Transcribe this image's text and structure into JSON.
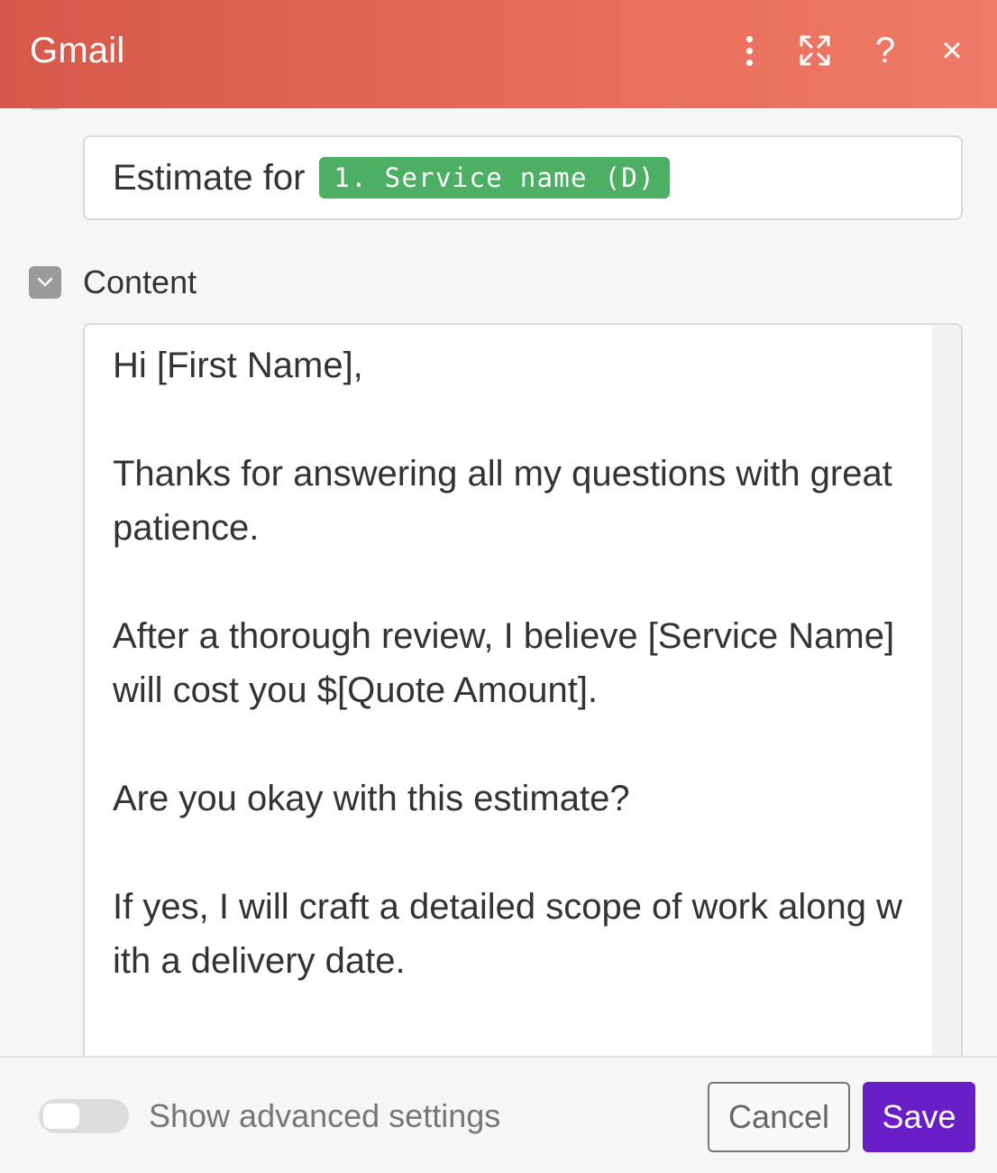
{
  "header": {
    "title": "Gmail",
    "icons": [
      "more-options-icon",
      "expand-icon",
      "help-icon",
      "close-icon"
    ],
    "help_label": "?",
    "close_label": "×",
    "gradient_colors": [
      "#d6584a",
      "#f07a67"
    ]
  },
  "subject": {
    "prefix_text": "Estimate for",
    "pill_text": "1. Service name (D)",
    "pill_color": "#4caf63"
  },
  "content": {
    "label": "Content",
    "paragraphs": [
      "Hi [First Name],",
      "Thanks for answering all my questions with great patience.",
      "After a thorough review, I believe [Service Name] will cost you $[Quote Amount].",
      "Are you okay with this estimate?",
      "If yes, I will craft a detailed scope of work along with a delivery date."
    ]
  },
  "footer": {
    "advanced_settings_label": "Show advanced settings",
    "advanced_settings_on": false,
    "cancel_label": "Cancel",
    "save_label": "Save",
    "save_color": "#6a1ec8"
  }
}
